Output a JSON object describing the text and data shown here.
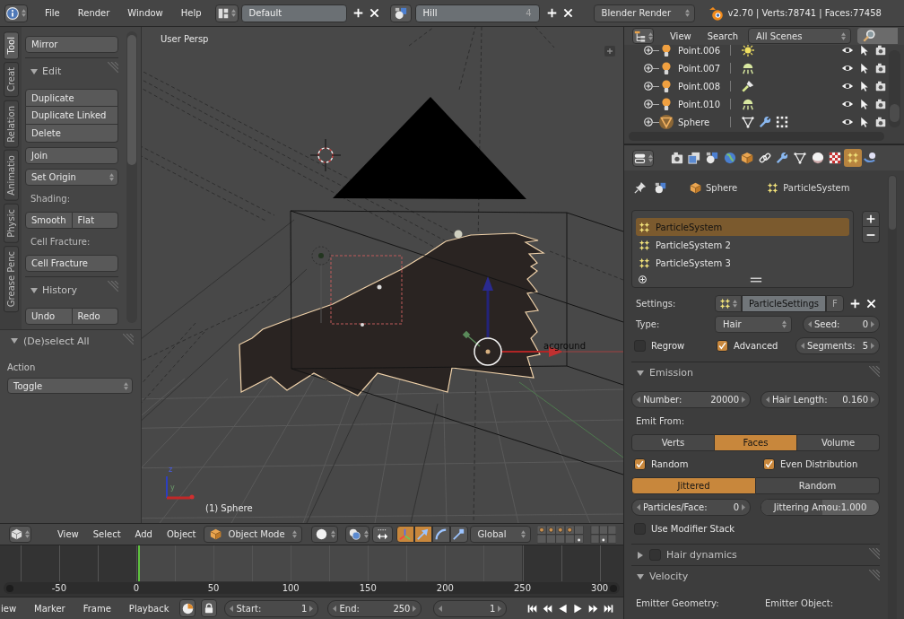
{
  "top_bar": {
    "menus": [
      "File",
      "Render",
      "Window",
      "Help"
    ],
    "screen_layout": "Default",
    "scene": "Hill",
    "scene_users": "4",
    "render_engine": "Blender Render",
    "stats": "v2.70 | Verts:78741 | Faces:77458"
  },
  "tool_shelf": {
    "tabs": [
      {
        "label": "Tool",
        "selected": true
      },
      {
        "label": "Creat",
        "selected": false
      },
      {
        "label": "Relation",
        "selected": false
      },
      {
        "label": "Animatio",
        "selected": false
      },
      {
        "label": "Physic",
        "selected": false
      },
      {
        "label": "Grease Penc",
        "selected": false
      }
    ],
    "items": [
      {
        "kind": "button",
        "label": "Mirror"
      },
      {
        "kind": "panel",
        "title": "Edit",
        "expanded": true,
        "items": [
          {
            "kind": "stack",
            "buttons": [
              "Duplicate",
              "Duplicate Linked",
              "Delete"
            ]
          },
          {
            "kind": "button",
            "label": "Join"
          },
          {
            "kind": "dropdown",
            "label": "Set Origin"
          },
          {
            "kind": "label",
            "label": "Shading:"
          },
          {
            "kind": "row",
            "buttons": [
              "Smooth",
              "Flat"
            ]
          },
          {
            "kind": "label",
            "label": "Cell Fracture:"
          },
          {
            "kind": "button",
            "label": "Cell Fracture"
          }
        ]
      },
      {
        "kind": "panel",
        "title": "History",
        "expanded": true,
        "items": [
          {
            "kind": "row",
            "buttons": [
              "Undo",
              "Redo"
            ]
          }
        ]
      }
    ],
    "operator": {
      "title": "(De)select All",
      "expanded": true,
      "label": "Action",
      "value": "Toggle"
    }
  },
  "viewport": {
    "view_name": "User Persp",
    "object_info": "(1) Sphere",
    "object_label": "acground",
    "axis_labels": [
      "z",
      "y"
    ]
  },
  "view3d_header": {
    "menus": [
      "View",
      "Select",
      "Add",
      "Object"
    ],
    "mode": "Object Mode",
    "manipulator": true,
    "manipulator_types": [
      {
        "kind": "translate",
        "selected": true
      },
      {
        "kind": "rotate",
        "selected": false
      },
      {
        "kind": "scale",
        "selected": false
      }
    ],
    "orientation": "Global"
  },
  "timeline": {
    "ruler": [
      "-50",
      "0",
      "50",
      "100",
      "150",
      "200",
      "250",
      "300"
    ],
    "menus": [
      "iew",
      "Marker",
      "Frame",
      "Playback"
    ],
    "start_label": "Start:",
    "start": "1",
    "end_label": "End:",
    "end": "250",
    "frame": "1"
  },
  "outliner": {
    "menus": [
      "View",
      "Search"
    ],
    "filter": "All Scenes",
    "rows": [
      {
        "name": "Point.006",
        "kind": "sun",
        "selected": false,
        "visible": true,
        "selectable": true,
        "renderable": true
      },
      {
        "name": "Point.007",
        "kind": "hemi",
        "selected": false,
        "visible": true,
        "selectable": true,
        "renderable": true
      },
      {
        "name": "Point.008",
        "kind": "spot",
        "selected": false,
        "visible": true,
        "selectable": true,
        "renderable": true
      },
      {
        "name": "Point.010",
        "kind": "hemi",
        "selected": false,
        "visible": true,
        "selectable": true,
        "renderable": true
      },
      {
        "name": "Sphere",
        "kind": "mesh",
        "selected": true,
        "visible": true,
        "selectable": true,
        "renderable": true
      }
    ]
  },
  "properties": {
    "tabs": [
      {
        "kind": "render",
        "selected": false
      },
      {
        "kind": "render_layers",
        "selected": false
      },
      {
        "kind": "scene",
        "selected": false
      },
      {
        "kind": "world",
        "selected": false
      },
      {
        "kind": "object",
        "selected": false
      },
      {
        "kind": "constraints",
        "selected": false
      },
      {
        "kind": "modifiers",
        "selected": false
      },
      {
        "kind": "data",
        "selected": false
      },
      {
        "kind": "material",
        "selected": false
      },
      {
        "kind": "texture",
        "selected": false
      },
      {
        "kind": "particles",
        "selected": true
      },
      {
        "kind": "physics",
        "selected": false
      }
    ],
    "breadcrumb": [
      {
        "kind": "object",
        "label": "Sphere"
      },
      {
        "kind": "particles",
        "label": "ParticleSystem"
      }
    ],
    "systems": [
      {
        "label": "ParticleSystem",
        "selected": true
      },
      {
        "label": "ParticleSystem 2",
        "selected": false
      },
      {
        "label": "ParticleSystem 3",
        "selected": false
      }
    ],
    "settings": {
      "label": "Settings:",
      "value": "ParticleSettings",
      "fake_user": "F"
    },
    "type": {
      "label": "Type:",
      "value": "Hair"
    },
    "seed": {
      "label": "Seed:",
      "value": "0"
    },
    "regrow": {
      "label": "Regrow",
      "checked": false
    },
    "advanced": {
      "label": "Advanced",
      "checked": true
    },
    "segments": {
      "label": "Segments:",
      "value": "5"
    },
    "panels": [
      {
        "title": "Emission",
        "expanded": true,
        "rows": [
          {
            "kind": "numbers",
            "items": [
              {
                "label": "Number:",
                "value": "20000"
              },
              {
                "label": "Hair Length:",
                "value": "0.160"
              }
            ]
          },
          {
            "kind": "label",
            "text": "Emit From:"
          },
          {
            "kind": "segmented",
            "options": [
              {
                "label": "Verts",
                "selected": false
              },
              {
                "label": "Faces",
                "selected": true
              },
              {
                "label": "Volume",
                "selected": false
              }
            ]
          },
          {
            "kind": "checks",
            "items": [
              {
                "label": "Random",
                "checked": true
              },
              {
                "label": "Even Distribution",
                "checked": true
              }
            ]
          },
          {
            "kind": "segmented",
            "options": [
              {
                "label": "Jittered",
                "selected": true
              },
              {
                "label": "Random",
                "selected": false
              }
            ]
          },
          {
            "kind": "numbers",
            "items": [
              {
                "label": "Particles/Face:",
                "value": "0"
              },
              {
                "label": "Jittering Amou:",
                "value": "1.000",
                "level": 0.52
              }
            ]
          },
          {
            "kind": "checks",
            "items": [
              {
                "label": "Use Modifier Stack",
                "checked": false
              }
            ]
          }
        ]
      },
      {
        "title": "Hair dynamics",
        "expanded": false,
        "enabled": false
      },
      {
        "title": "Velocity",
        "expanded": true,
        "rows": [
          {
            "kind": "labels",
            "texts": [
              "Emitter Geometry:",
              "Emitter Object:"
            ]
          }
        ]
      }
    ]
  }
}
